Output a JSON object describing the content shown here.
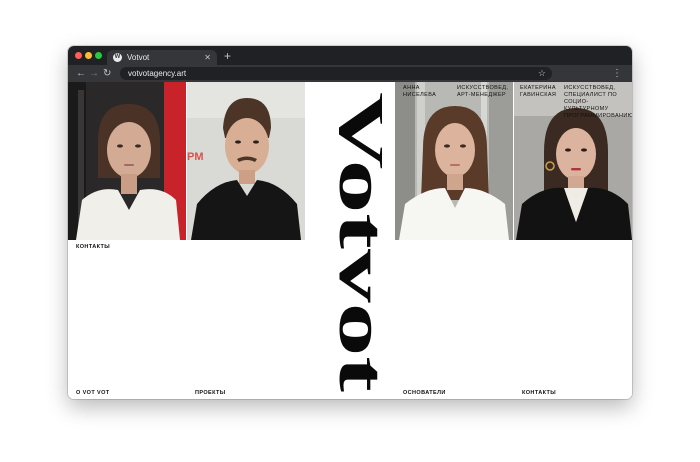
{
  "browser": {
    "tab_title": "Votvot",
    "tab_favicon": "wordpress-icon",
    "tab_close": "✕",
    "new_tab": "+",
    "url": "votvotagency.art",
    "nav_back": "←",
    "nav_forward": "→",
    "nav_reload": "↻",
    "bookmark_icon": "☆",
    "menu_icon": "⋮"
  },
  "site": {
    "logo_text": "Votvot",
    "contacts_top": "КОНТАКТЫ",
    "founders": [
      {
        "name": "АННА НИСЕЛЕВА",
        "role": "ИСКУССТВОВЕД, АРТ-МЕНЕДЖЕР"
      },
      {
        "name": "ЕКАТЕРИНА ГАВИНСКАЯ",
        "role": "ИСКУССТВОВЕД, СПЕЦИАЛИСТ ПО СОЦИО-КУЛЬТУРНОМУ ПРОГРАММИРОВАНИЮ"
      }
    ],
    "nav": {
      "about": "О VOT VOT",
      "projects": "ПРОЕКТЫ",
      "founders": "ОСНОВАТЕЛИ",
      "contacts": "КОНТАКТЫ"
    },
    "photo_sign_text": "PM"
  }
}
